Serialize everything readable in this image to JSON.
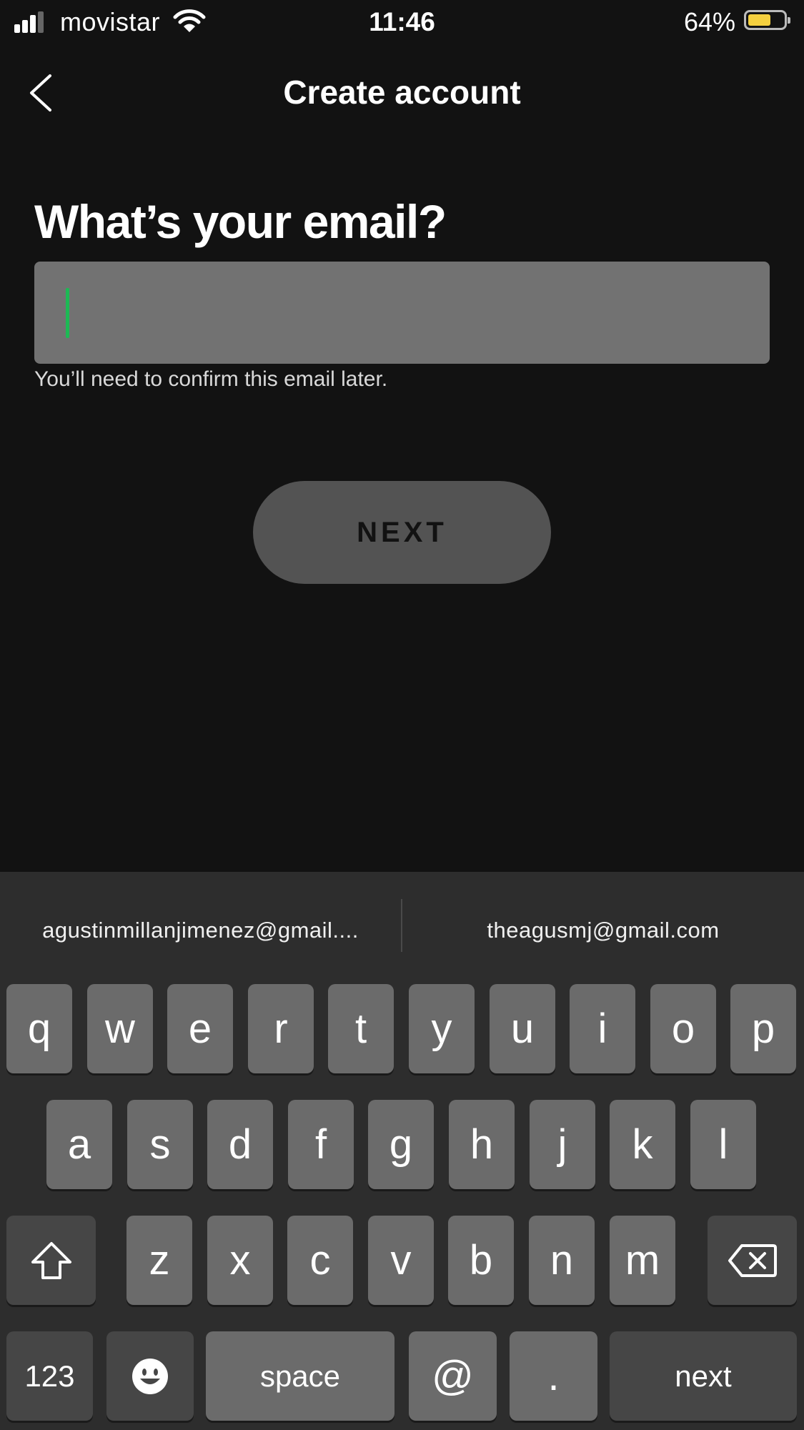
{
  "status_bar": {
    "carrier": "movistar",
    "time": "11:46",
    "battery_percent_text": "64%",
    "battery_level": 0.64,
    "signal_bars": 3,
    "battery_color": "#f4d03f"
  },
  "nav": {
    "title": "Create account",
    "back_icon": "chevron-left-icon"
  },
  "form": {
    "question": "What’s your email?",
    "email_value": "",
    "helper_text": "You’ll need to confirm this email later.",
    "caret_color": "#1db954"
  },
  "next_button": {
    "label": "NEXT"
  },
  "keyboard": {
    "suggestions": [
      "agustinmillanjimenez@gmail....",
      "theagusmj@gmail.com"
    ],
    "row1": [
      "q",
      "w",
      "e",
      "r",
      "t",
      "y",
      "u",
      "i",
      "o",
      "p"
    ],
    "row2": [
      "a",
      "s",
      "d",
      "f",
      "g",
      "h",
      "j",
      "k",
      "l"
    ],
    "row3": [
      "z",
      "x",
      "c",
      "v",
      "b",
      "n",
      "m"
    ],
    "shift_icon": "shift-arrow-icon",
    "delete_icon": "backspace-icon",
    "emoji_icon": "emoji-smile-icon",
    "numbers_label": "123",
    "space_label": "space",
    "at_label": "@",
    "period_label": ".",
    "return_label": "next"
  }
}
